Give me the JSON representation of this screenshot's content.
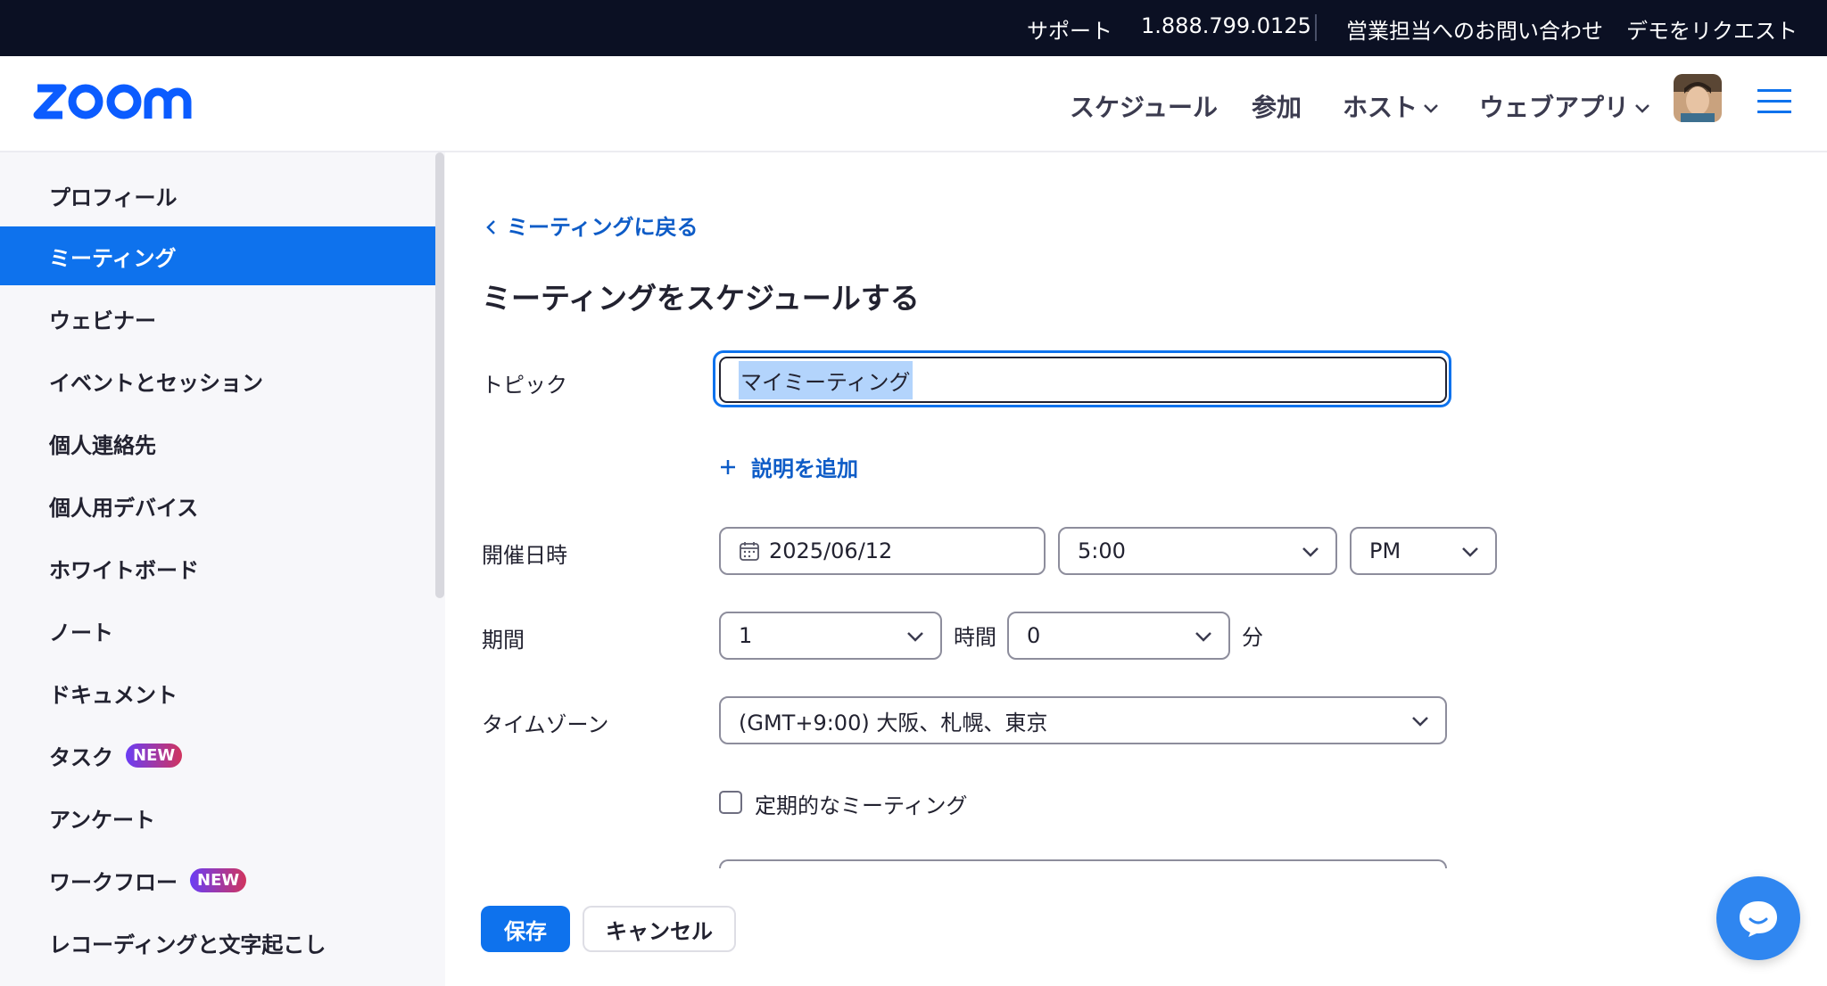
{
  "topbar": {
    "support": "サポート",
    "phone": "1.888.799.0125",
    "contact_sales": "営業担当へのお問い合わせ",
    "request_demo": "デモをリクエスト"
  },
  "header": {
    "nav": {
      "schedule": "スケジュール",
      "join": "参加",
      "host": "ホスト",
      "web_app": "ウェブアプリ"
    }
  },
  "sidebar": {
    "items": [
      {
        "label": "プロフィール"
      },
      {
        "label": "ミーティング",
        "active": true
      },
      {
        "label": "ウェビナー"
      },
      {
        "label": "イベントとセッション"
      },
      {
        "label": "個人連絡先"
      },
      {
        "label": "個人用デバイス"
      },
      {
        "label": "ホワイトボード"
      },
      {
        "label": "ノート"
      },
      {
        "label": "ドキュメント"
      },
      {
        "label": "タスク",
        "badge": "NEW"
      },
      {
        "label": "アンケート"
      },
      {
        "label": "ワークフロー",
        "badge": "NEW"
      },
      {
        "label": "レコーディングと文字起こし"
      }
    ]
  },
  "main": {
    "back_link": "ミーティングに戻る",
    "title": "ミーティングをスケジュールする",
    "topic": {
      "label": "トピック",
      "value": "マイミーティング"
    },
    "add_description": "説明を追加",
    "datetime": {
      "label": "開催日時",
      "date": "2025/06/12",
      "time": "5:00",
      "ampm": "PM"
    },
    "duration": {
      "label": "期間",
      "hours": "1",
      "hours_unit": "時間",
      "minutes": "0",
      "minutes_unit": "分"
    },
    "timezone": {
      "label": "タイムゾーン",
      "value": "(GMT+9:00) 大阪、札幌、東京"
    },
    "recurring": {
      "label": "定期的なミーティング",
      "checked": false
    },
    "save": "保存",
    "cancel": "キャンセル"
  },
  "colors": {
    "brand": "#0b5cff",
    "accent": "#0e72ed",
    "topbar": "#0b1023"
  }
}
